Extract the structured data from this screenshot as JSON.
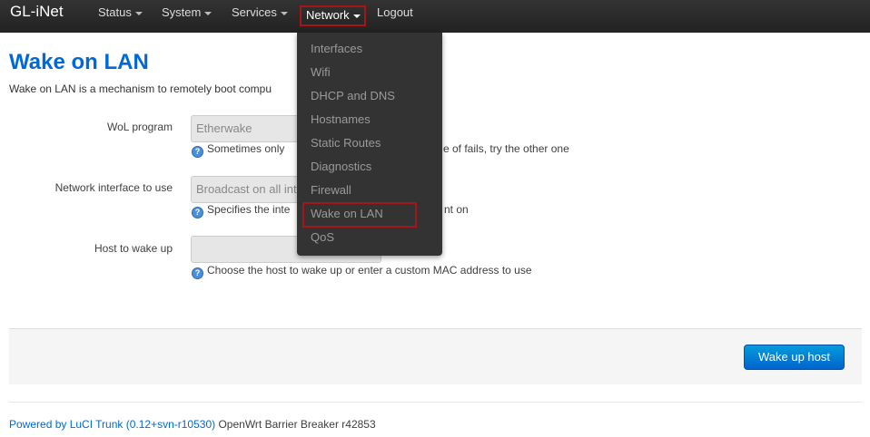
{
  "navbar": {
    "brand": "GL-iNet",
    "items": [
      {
        "label": "Status"
      },
      {
        "label": "System"
      },
      {
        "label": "Services"
      },
      {
        "label": "Network"
      },
      {
        "label": "Logout"
      }
    ]
  },
  "network_menu": {
    "items": [
      {
        "label": "Interfaces"
      },
      {
        "label": "Wifi"
      },
      {
        "label": "DHCP and DNS"
      },
      {
        "label": "Hostnames"
      },
      {
        "label": "Static Routes"
      },
      {
        "label": "Diagnostics"
      },
      {
        "label": "Firewall"
      },
      {
        "label": "Wake on LAN"
      },
      {
        "label": "QoS"
      }
    ],
    "highlighted_item": "Wake on LAN"
  },
  "page": {
    "title": "Wake on LAN",
    "description_visible": "Wake on LAN is a mechanism to remotely boot compu"
  },
  "form": {
    "wol_program": {
      "label": "WoL program",
      "value": "Etherwake",
      "help_left": "Sometimes only",
      "help_right": "e of fails, try the other one"
    },
    "interface": {
      "label": "Network interface to use",
      "value": "Broadcast on all int",
      "help_left": "Specifies the inte",
      "help_right": "nt on"
    },
    "host": {
      "label": "Host to wake up",
      "value": "",
      "help": "Choose the host to wake up or enter a custom MAC address to use"
    },
    "help_icon_glyph": "?"
  },
  "actions": {
    "wake_button": "Wake up host"
  },
  "footer": {
    "link": "Powered by LuCI Trunk (0.12+svn-r10530)",
    "text": " OpenWrt Barrier Breaker r42853"
  },
  "colors": {
    "accent": "#0069d6",
    "navbar": "#2a2a2a",
    "highlight_border": "#a3171c"
  }
}
